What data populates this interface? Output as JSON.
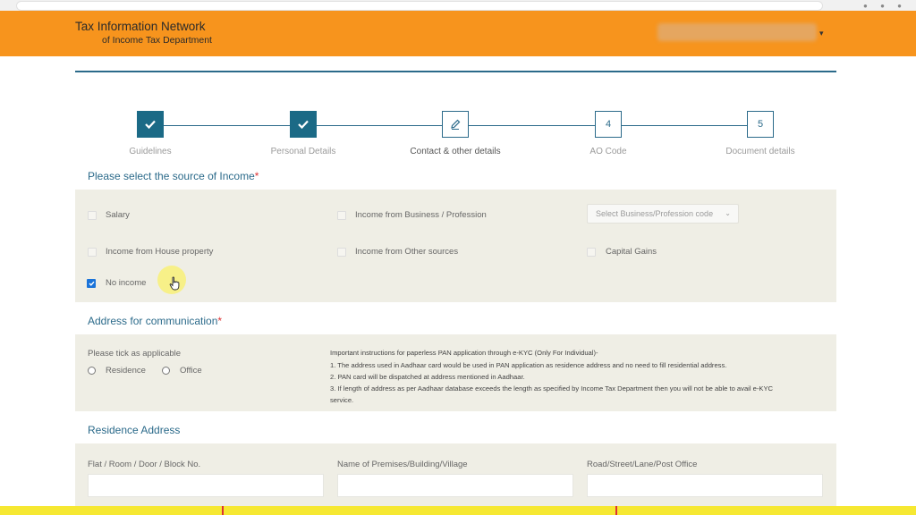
{
  "header": {
    "title": "Tax Information Network",
    "subtitle": "of Income Tax Department"
  },
  "stepper": {
    "steps": [
      {
        "label": "Guidelines",
        "marker": "",
        "state": "done"
      },
      {
        "label": "Personal Details",
        "marker": "",
        "state": "done"
      },
      {
        "label": "Contact & other details",
        "marker": "",
        "state": "current"
      },
      {
        "label": "AO Code",
        "marker": "4",
        "state": "pending"
      },
      {
        "label": "Document details",
        "marker": "5",
        "state": "pending"
      }
    ]
  },
  "income": {
    "title": "Please select the source of Income",
    "required_mark": "*",
    "options": [
      {
        "label": "Salary",
        "checked": false
      },
      {
        "label": "Income from Business / Profession",
        "checked": false
      },
      {
        "label": "Income from House property",
        "checked": false
      },
      {
        "label": "Income from Other sources",
        "checked": false
      },
      {
        "label": "Capital Gains",
        "checked": false
      },
      {
        "label": "No income",
        "checked": true
      }
    ],
    "business_select_placeholder": "Select Business/Profession code"
  },
  "address": {
    "title": "Address for communication",
    "required_mark": "*",
    "prompt": "Please tick as applicable",
    "radios": [
      "Residence",
      "Office"
    ],
    "instructions": [
      "Important instructions for paperless PAN application through e-KYC (Only For Individual)-",
      "1. The address used in Aadhaar card would be used in PAN application as residence address and no need to fill residential address.",
      "2. PAN card will be dispatched at address mentioned in Aadhaar.",
      "3. If length of address as per Aadhaar database exceeds the length as specified by Income Tax Department then you will not be able to avail e-KYC",
      "service."
    ]
  },
  "residence": {
    "title": "Residence Address",
    "fields": [
      {
        "label": "Flat / Room / Door / Block No.",
        "value": ""
      },
      {
        "label": "Name of Premises/Building/Village",
        "value": ""
      },
      {
        "label": "Road/Street/Lane/Post Office",
        "value": ""
      }
    ]
  },
  "colors": {
    "header_orange": "#f7941d",
    "accent_teal": "#2b6a8a",
    "panel_beige": "#efeee5",
    "required_red": "#dd3333",
    "checkbox_blue": "#1a73d9"
  }
}
